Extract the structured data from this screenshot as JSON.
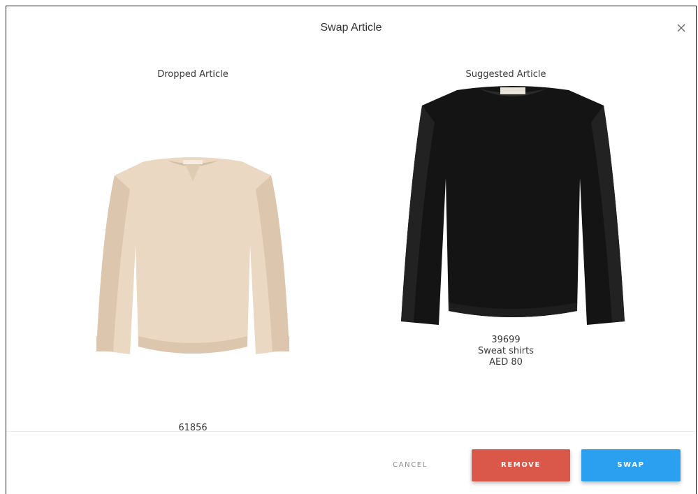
{
  "dialog": {
    "title": "Swap Article",
    "close_icon": "close-icon"
  },
  "dropped": {
    "label": "Dropped Article",
    "article_number": "61856",
    "image_icon": "beige-sweatshirt-image",
    "image_color": "#e9d6c1"
  },
  "suggested": {
    "label": "Suggested Article",
    "article_number": "39699",
    "category": "Sweat shirts",
    "price": "AED 80",
    "image_icon": "black-sweater-image",
    "image_color": "#161616"
  },
  "actions": {
    "cancel_label": "CANCEL",
    "remove_label": "REMOVE",
    "swap_label": "SWAP"
  },
  "colors": {
    "remove": "#d9584a",
    "swap": "#2b9ff0"
  }
}
